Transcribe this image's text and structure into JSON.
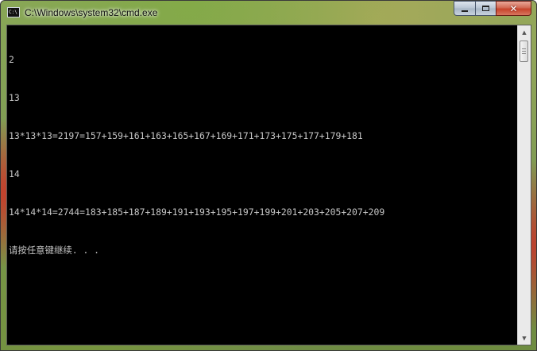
{
  "window": {
    "title": "C:\\Windows\\system32\\cmd.exe",
    "icon": "cmd-icon",
    "icon_text": "C:\\"
  },
  "caption_buttons": {
    "minimize_icon": "minimize-icon",
    "maximize_icon": "maximize-icon",
    "close_icon": "close-icon",
    "close_glyph": "✕"
  },
  "console": {
    "lines": [
      "2",
      "13",
      "13*13*13=2197=157+159+161+163+165+167+169+171+173+175+177+179+181",
      "14",
      "14*14*14=2744=183+185+187+189+191+193+195+197+199+201+203+205+207+209",
      "请按任意键继续. . ."
    ],
    "text_color": "#c6c6c6",
    "background_color": "#000000"
  },
  "scrollbar": {
    "up_glyph": "▲",
    "down_glyph": "▼"
  }
}
